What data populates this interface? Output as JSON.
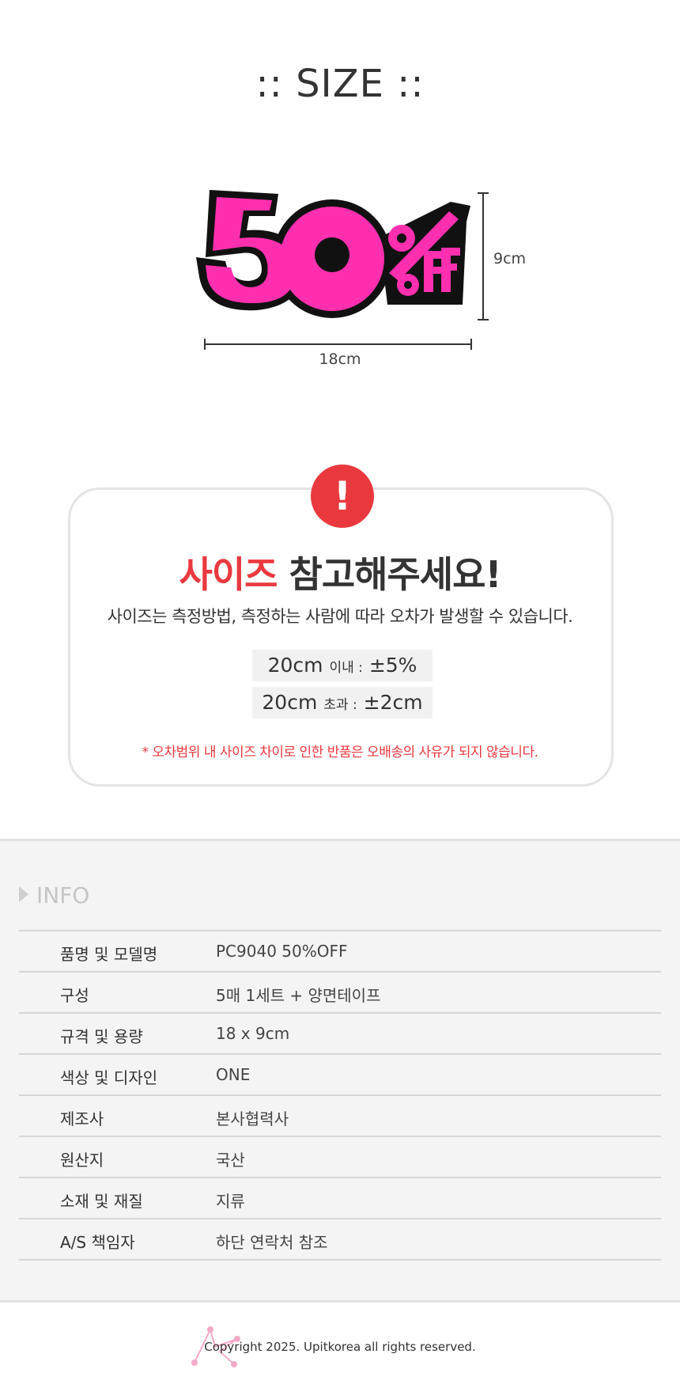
{
  "size_section": {
    "title": ":: SIZE ::",
    "width_label": "18cm",
    "height_label": "9cm"
  },
  "product": {
    "sticker_text_main": "50",
    "sticker_text_percent": "%",
    "sticker_text_off": "OFF",
    "colors": {
      "fill": "#ff2fb0",
      "outline": "#111111"
    }
  },
  "notice": {
    "icon_text": "!",
    "heading_accent": "사이즈",
    "heading_rest": "참고해주세요!",
    "description": "사이즈는 측정방법, 측정하는 사람에 따라 오차가 발생할 수 있습니다.",
    "tolerance": [
      {
        "size": "20cm",
        "condition": "이내 :",
        "value": "±5%"
      },
      {
        "size": "20cm",
        "condition": "초과 :",
        "value": "±2cm"
      }
    ],
    "warning": "* 오차범위 내 사이즈 차이로 인한 반품은 오배송의 사유가 되지 않습니다.",
    "accent_color": "#e9393f"
  },
  "info": {
    "title": "INFO",
    "rows": [
      {
        "key": "품명 및 모델명",
        "value": "PC9040 50%OFF"
      },
      {
        "key": "구성",
        "value": "5매 1세트 + 양면테이프"
      },
      {
        "key": "규격 및 용량",
        "value": "18 x 9cm"
      },
      {
        "key": "색상 및 디자인",
        "value": "ONE"
      },
      {
        "key": "제조사",
        "value": "본사협력사"
      },
      {
        "key": "원산지",
        "value": "국산"
      },
      {
        "key": "소재 및 재질",
        "value": "지류"
      },
      {
        "key": "A/S 책임자",
        "value": "하단 연락처 참조"
      }
    ]
  },
  "footer": {
    "copyright": "Copyright 2025. Upitkorea all rights reserved."
  }
}
